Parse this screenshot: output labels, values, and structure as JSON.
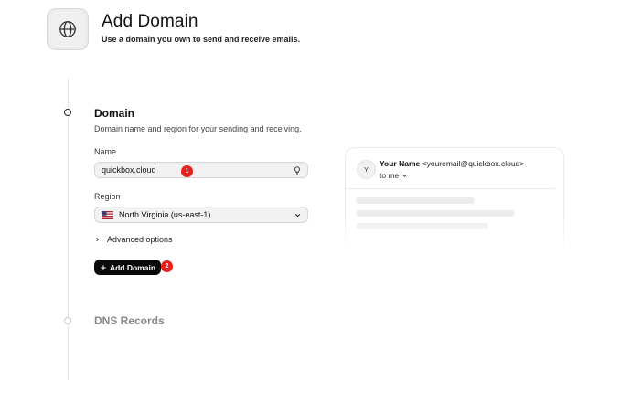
{
  "header": {
    "icon": "globe-icon",
    "title": "Add Domain",
    "subtitle": "Use a domain you own to send and receive emails."
  },
  "steps": [
    {
      "title": "Domain",
      "state": "active"
    },
    {
      "title": "DNS Records",
      "state": "inactive"
    }
  ],
  "domain_section": {
    "title": "Domain",
    "description": "Domain name and region for your sending and receiving.",
    "name_label": "Name",
    "name_value": "quickbox.cloud",
    "name_icon": "lightbulb-icon",
    "region_label": "Region",
    "region_value": "North Virginia (us-east-1)",
    "region_flag": "us-flag-icon",
    "advanced_label": "Advanced options",
    "add_button_label": "Add Domain"
  },
  "annotations": {
    "badge_1": "1",
    "badge_2": "2"
  },
  "dns_section": {
    "title": "DNS Records"
  },
  "preview": {
    "avatar_initial": "Y",
    "sender_name": "Your Name",
    "sender_email": "<youremail@quickbox.cloud>",
    "recipient": "to me"
  },
  "colors": {
    "accent": "#0a0a0a",
    "badge": "#e8201c",
    "muted_heading": "#888888"
  }
}
